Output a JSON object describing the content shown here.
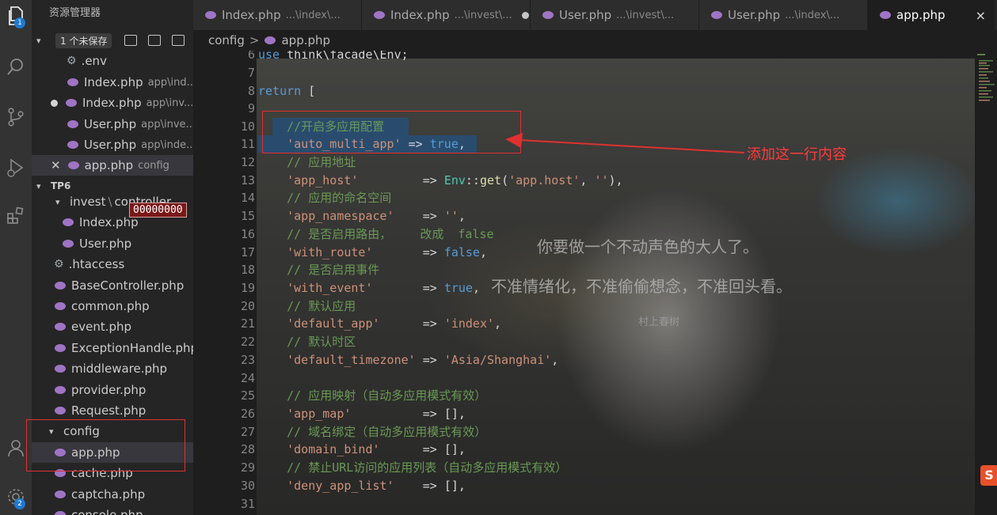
{
  "activity_bar": {
    "explorer_badge": "1",
    "settings_badge": "2",
    "icons": [
      "files-icon",
      "search-icon",
      "source-control-icon",
      "run-debug-icon",
      "extensions-icon",
      "account-icon",
      "settings-gear-icon"
    ]
  },
  "sidebar": {
    "title": "资源管理器",
    "open_editors": {
      "unsaved_label": "1 个未保存",
      "items": [
        {
          "name": ".env",
          "desc": "",
          "icon": "gear"
        },
        {
          "name": "Index.php",
          "desc": "app\\ind...",
          "icon": "php"
        },
        {
          "name": "Index.php",
          "desc": "app\\inv...",
          "icon": "php",
          "modified": true
        },
        {
          "name": "User.php",
          "desc": "app\\inve...",
          "icon": "php"
        },
        {
          "name": "User.php",
          "desc": "app\\inde...",
          "icon": "php"
        },
        {
          "name": "app.php",
          "desc": "config",
          "icon": "php",
          "active": true
        }
      ]
    },
    "project": {
      "name": "TP6",
      "invest_folder": "invest",
      "invest_sep": "\\",
      "invest_sub": "controller",
      "tooltip_hex": "00000000",
      "invest_files": [
        "Index.php",
        "User.php"
      ],
      "root_files": [
        ".htaccess",
        "BaseController.php",
        "common.php",
        "event.php",
        "ExceptionHandle.php",
        "middleware.php",
        "provider.php",
        "Request.php"
      ],
      "config_folder": "config",
      "config_files": [
        "app.php",
        "cache.php",
        "captcha.php",
        "console.php"
      ]
    }
  },
  "tabs": [
    {
      "label": "Index.php",
      "desc": "...\\index\\..."
    },
    {
      "label": "Index.php",
      "desc": "...\\invest\\...",
      "modified": true
    },
    {
      "label": "User.php",
      "desc": "...\\invest\\..."
    },
    {
      "label": "User.php",
      "desc": "...\\index\\..."
    },
    {
      "label": "app.php",
      "desc": "",
      "active": true
    }
  ],
  "tab_close": "×",
  "breadcrumb": {
    "folder": "config",
    "sep": ">",
    "file": "app.php"
  },
  "line_numbers": [
    "6",
    "7",
    "8",
    "9",
    "10",
    "11",
    "12",
    "13",
    "14",
    "15",
    "16",
    "17",
    "18",
    "19",
    "20",
    "21",
    "22",
    "23",
    "24",
    "25",
    "26",
    "27",
    "28",
    "29",
    "30",
    "31"
  ],
  "code": {
    "l6_use": "use",
    "l6_rest": " think\\facade\\Env;",
    "l8_return": "return",
    "l8_rest": " [",
    "l10": "    //开启多应用配置",
    "l11_key": "    'auto_multi_app'",
    "l11_arrow": " => ",
    "l11_val": "true",
    "l11_end": ",",
    "l12": "    // 应用地址",
    "l13_key": "    'app_host'",
    "l13_arrow": "         => ",
    "l13_cls": "Env",
    "l13_op": "::",
    "l13_fn": "get",
    "l13_args_open": "(",
    "l13_arg1": "'app.host'",
    "l13_comma": ", ",
    "l13_arg2": "''",
    "l13_end": "),",
    "l14": "    // 应用的命名空间",
    "l15_key": "    'app_namespace'",
    "l15_arrow": "    => ",
    "l15_val": "''",
    "l15_end": ",",
    "l16": "    // 是否启用路由，    改成  false",
    "l17_key": "    'with_route'",
    "l17_arrow": "       => ",
    "l17_val": "false",
    "l17_end": ",",
    "l18": "    // 是否启用事件",
    "l19_key": "    'with_event'",
    "l19_arrow": "       => ",
    "l19_val": "true",
    "l19_end": ",",
    "l20": "    // 默认应用",
    "l21_key": "    'default_app'",
    "l21_arrow": "      => ",
    "l21_val": "'index'",
    "l21_end": ",",
    "l22": "    // 默认时区",
    "l23_key": "    'default_timezone'",
    "l23_arrow": " => ",
    "l23_val": "'Asia/Shanghai'",
    "l23_end": ",",
    "l25": "    // 应用映射（自动多应用模式有效）",
    "l26_key": "    'app_map'",
    "l26_arrow": "          => ",
    "l26_val": "[]",
    "l26_end": ",",
    "l27": "    // 域名绑定（自动多应用模式有效）",
    "l28_key": "    'domain_bind'",
    "l28_arrow": "      => ",
    "l28_val": "[]",
    "l28_end": ",",
    "l29": "    // 禁止URL访问的应用列表（自动多应用模式有效）",
    "l30_key": "    'deny_app_list'",
    "l30_arrow": "    => ",
    "l30_val": "[]",
    "l30_end": ","
  },
  "annotation": {
    "text": "添加这一行内容",
    "color": "#ff3b3b"
  },
  "wallpaper_quote": {
    "line1": "你要做一个不动声色的大人了。",
    "line2": "不准情绪化，不准偷偷想念，不准回头看。",
    "author": "村上春树"
  },
  "ime_label": "S"
}
